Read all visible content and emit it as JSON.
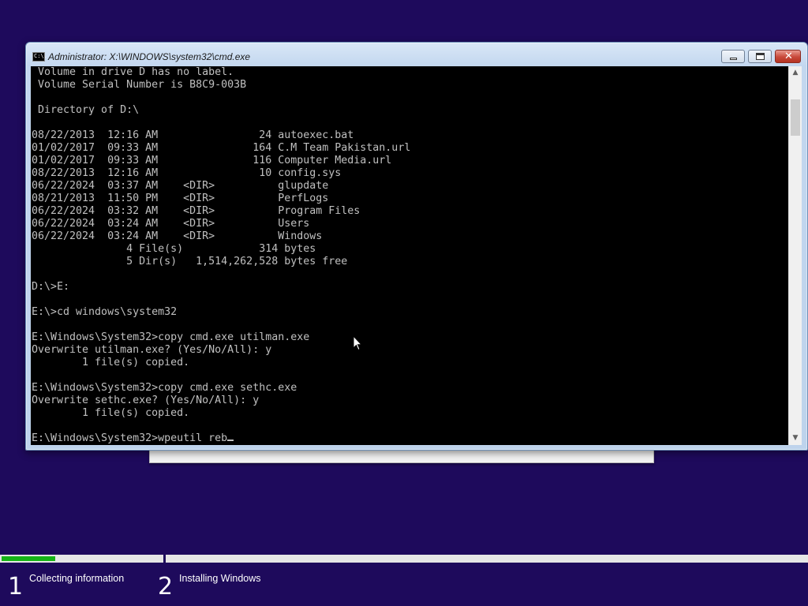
{
  "window": {
    "title": "Administrator: X:\\WINDOWS\\system32\\cmd.exe",
    "icon": "cmd-icon",
    "icon_text": "C:\\."
  },
  "console": {
    "lines": [
      " Volume in drive D has no label.",
      " Volume Serial Number is B8C9-003B",
      "",
      " Directory of D:\\",
      "",
      "08/22/2013  12:16 AM                24 autoexec.bat",
      "01/02/2017  09:33 AM               164 C.M Team Pakistan.url",
      "01/02/2017  09:33 AM               116 Computer Media.url",
      "08/22/2013  12:16 AM                10 config.sys",
      "06/22/2024  03:37 AM    <DIR>          glupdate",
      "08/21/2013  11:50 PM    <DIR>          PerfLogs",
      "06/22/2024  03:32 AM    <DIR>          Program Files",
      "06/22/2024  03:24 AM    <DIR>          Users",
      "06/22/2024  03:24 AM    <DIR>          Windows",
      "               4 File(s)            314 bytes",
      "               5 Dir(s)   1,514,262,528 bytes free",
      "",
      "D:\\>E:",
      "",
      "E:\\>cd windows\\system32",
      "",
      "E:\\Windows\\System32>copy cmd.exe utilman.exe",
      "Overwrite utilman.exe? (Yes/No/All): y",
      "        1 file(s) copied.",
      "",
      "E:\\Windows\\System32>copy cmd.exe sethc.exe",
      "Overwrite sethc.exe? (Yes/No/All): y",
      "        1 file(s) copied.",
      ""
    ],
    "current_input": "E:\\Windows\\System32>wpeutil reb"
  },
  "setup": {
    "progress": {
      "step1_fraction": 0.33,
      "fill_color": "#16b316"
    },
    "steps": [
      {
        "number": "1",
        "label": "Collecting information"
      },
      {
        "number": "2",
        "label": "Installing Windows"
      }
    ]
  },
  "colors": {
    "background": "#1e0a5c",
    "console_bg": "#000000",
    "console_fg": "#c0c0c0"
  },
  "icons": [
    "cmd-icon",
    "minimize-icon",
    "maximize-icon",
    "close-icon",
    "scroll-up-arrow-icon",
    "scroll-down-arrow-icon",
    "mouse-pointer-icon"
  ]
}
